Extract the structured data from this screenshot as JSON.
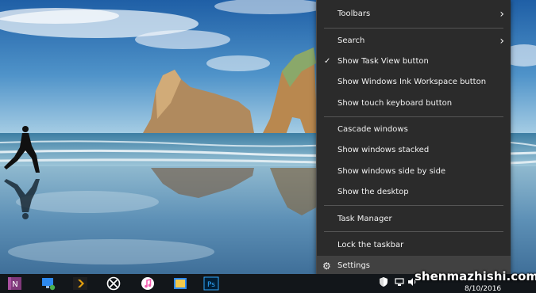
{
  "context_menu": {
    "items": [
      {
        "label": "Toolbars",
        "submenu": true
      },
      {
        "label": "Search",
        "submenu": true
      },
      {
        "label": "Show Task View button",
        "checked": true
      },
      {
        "label": "Show Windows Ink Workspace button"
      },
      {
        "label": "Show touch keyboard button"
      },
      {
        "label": "Cascade windows"
      },
      {
        "label": "Show windows stacked"
      },
      {
        "label": "Show windows side by side"
      },
      {
        "label": "Show the desktop"
      },
      {
        "label": "Task Manager"
      },
      {
        "label": "Lock the taskbar"
      },
      {
        "label": "Settings",
        "icon": "gear-icon",
        "highlighted": true
      }
    ],
    "chevron_glyph": "›",
    "check_glyph": "✓",
    "gear_glyph": "⚙"
  },
  "taskbar": {
    "apps": [
      {
        "icon": "onenote-icon",
        "color": "#80397b"
      },
      {
        "icon": "network-computer-icon",
        "color": "#2d89ef"
      },
      {
        "icon": "plex-icon",
        "color": "#e5a00d"
      },
      {
        "icon": "xbox-icon",
        "color": "#ffffff"
      },
      {
        "icon": "itunes-icon",
        "color": "#f45bb0"
      },
      {
        "icon": "app-window-icon",
        "color": "#f2c94c"
      },
      {
        "icon": "photoshop-icon",
        "color": "#31a8ff",
        "label": "Ps"
      }
    ],
    "tray_icons": [
      "shield-icon",
      "network-icon",
      "volume-icon"
    ],
    "clock_date": "8/10/2016"
  },
  "watermark": "shenmazhishi.com",
  "colors": {
    "menu_bg": "#2b2b2b",
    "menu_text": "#f2f2f2",
    "menu_highlight": "#414141",
    "taskbar_bg": "#12161a"
  }
}
